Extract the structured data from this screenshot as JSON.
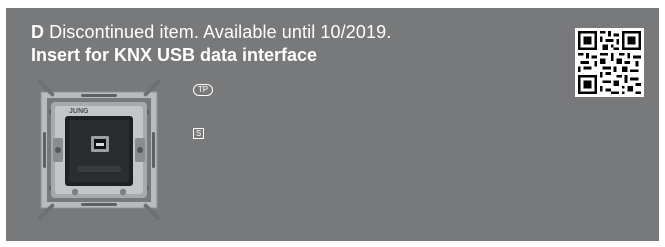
{
  "header": {
    "badge_letter": "D",
    "status_text": "Discontinued item. Available until 10/2019.",
    "product_title": "Insert for KNX USB data interface"
  },
  "symbols": {
    "tp_label": "TP",
    "s_label": "S"
  },
  "product_image": {
    "brand_marking": "JUNG"
  },
  "colors": {
    "panel_background": "#77797b",
    "text": "#ffffff"
  },
  "icons": [
    "qr-code-icon",
    "tp-symbol-icon",
    "s-symbol-icon"
  ]
}
